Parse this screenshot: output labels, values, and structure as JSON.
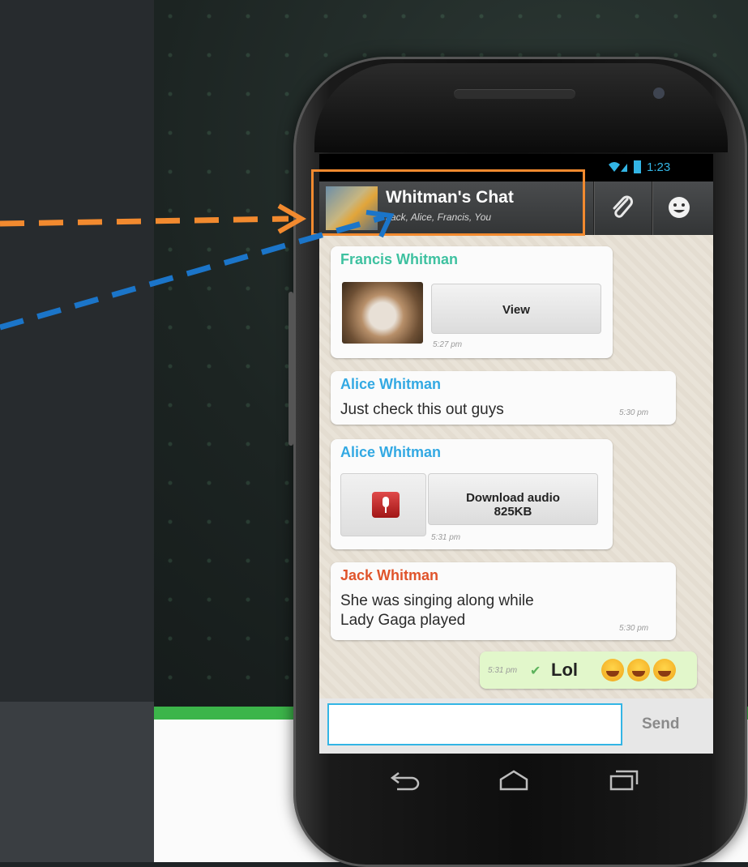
{
  "status_bar": {
    "time": "1:23",
    "wifi_icon": "wifi-icon",
    "battery_icon": "battery-icon"
  },
  "chat_header": {
    "title": "Whitman's Chat",
    "participants": "Jack, Alice, Francis, You",
    "attach_icon": "paperclip-icon",
    "emoji_icon": "smiley-icon"
  },
  "messages": [
    {
      "sender": "Francis Whitman",
      "sender_color": "#3ec1a0",
      "type": "image",
      "button_label": "View",
      "time": "5:27 pm"
    },
    {
      "sender": "Alice Whitman",
      "sender_color": "#33a9e3",
      "type": "text",
      "text": "Just check this out guys",
      "time": "5:30 pm"
    },
    {
      "sender": "Alice Whitman",
      "sender_color": "#33a9e3",
      "type": "audio",
      "button_label_1": "Download audio",
      "button_label_2": "825KB",
      "time": "5:31 pm"
    },
    {
      "sender": "Jack Whitman",
      "sender_color": "#e0542b",
      "type": "text",
      "text_line1": "She was singing along while",
      "text_line2": "Lady Gaga played",
      "time": "5:30 pm"
    }
  ],
  "outgoing": {
    "time": "5:31 pm",
    "status": "✔",
    "text": "Lol"
  },
  "composer": {
    "placeholder": "",
    "value": "",
    "send_label": "Send"
  },
  "colors": {
    "highlight_orange": "#f28a2f",
    "arrow_blue": "#1b75c9",
    "accent_blue": "#33b5e5",
    "brand_green": "#3cb54a"
  }
}
